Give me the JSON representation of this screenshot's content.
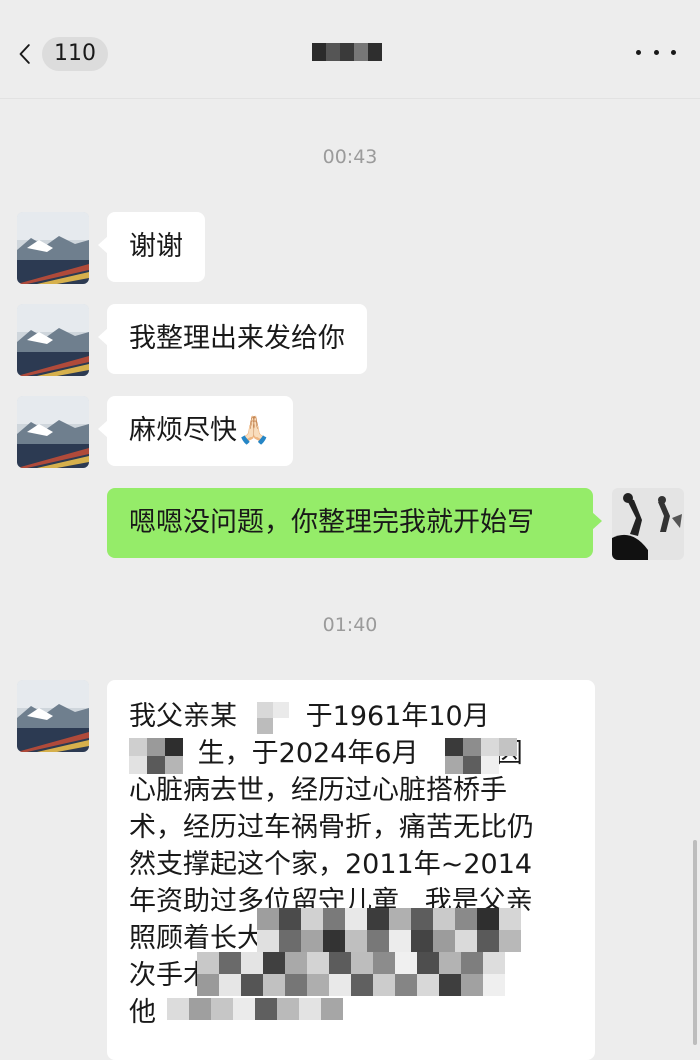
{
  "header": {
    "unread_count": "110"
  },
  "messages": [
    {
      "type": "time",
      "text": "00:43"
    },
    {
      "type": "in",
      "text": "谢谢"
    },
    {
      "type": "in",
      "text": "我整理出来发给你"
    },
    {
      "type": "in",
      "text": "麻烦尽快🙏🏻"
    },
    {
      "type": "out",
      "text": "嗯嗯没问题，你整理完我就开始写"
    },
    {
      "type": "time",
      "text": "01:40"
    },
    {
      "type": "in_long",
      "text": "我父亲某        于1961年10月\n        生，于2024年6月         因\n心脏病去世，经历过心脏搭桥手\n术，经历过车祸骨折，痛苦无比仍\n然支撑起这个家，2011年~2014\n年资助过多位留守儿童   我是父亲\n照顾着长大\n次手术\n他"
    }
  ],
  "colors": {
    "background": "#ededed",
    "incoming_bubble": "#ffffff",
    "outgoing_bubble": "#95ec69",
    "timestamp_text": "#9b9b9b"
  },
  "icons": {
    "back": "chevron-left-icon",
    "more": "more-dots-icon"
  }
}
